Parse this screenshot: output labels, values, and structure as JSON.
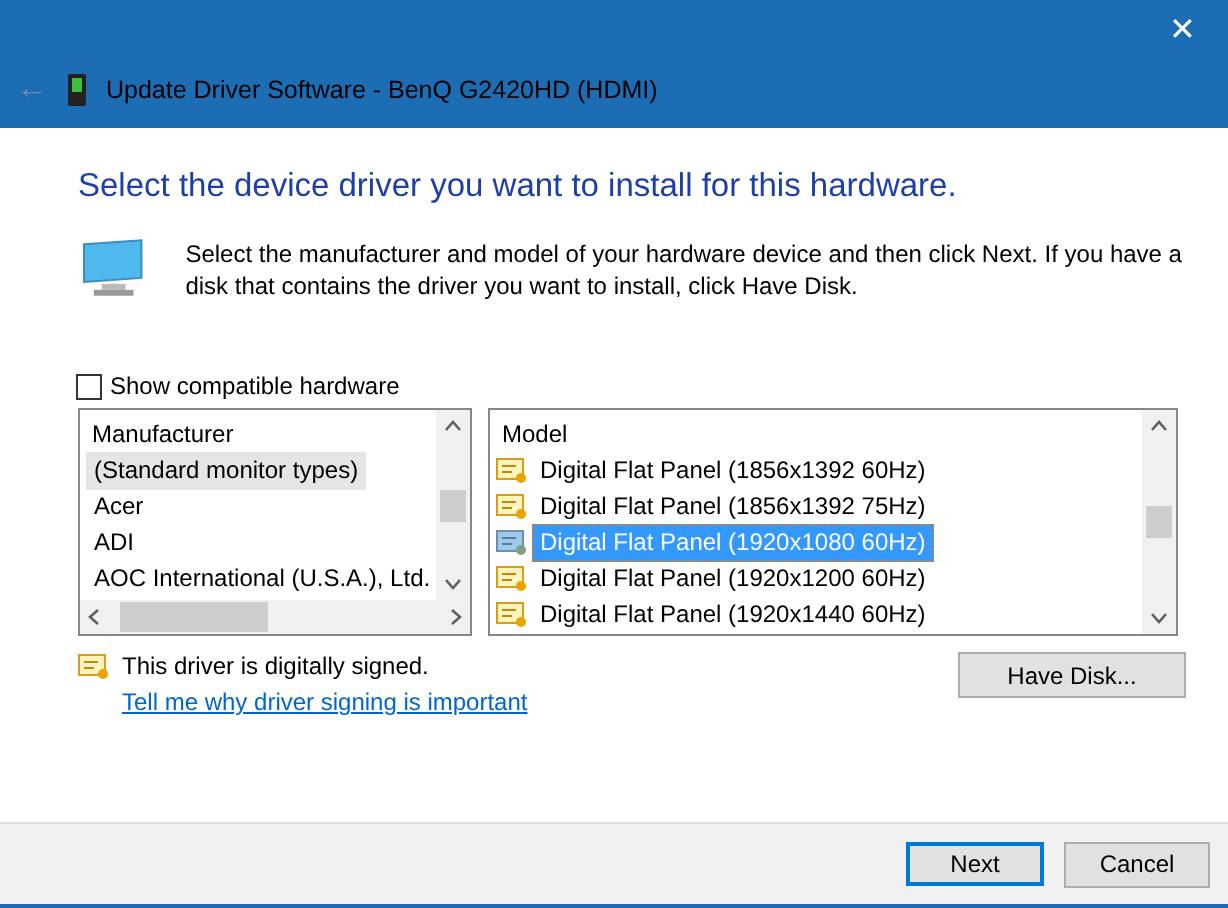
{
  "window": {
    "title": "Update Driver Software - BenQ G2420HD (HDMI)",
    "close": "✕",
    "back": "←"
  },
  "heading": "Select the device driver you want to install for this hardware.",
  "description": "Select the manufacturer and model of your hardware device and then click Next. If you have a disk that contains the driver you want to install, click Have Disk.",
  "show_compatible": {
    "label": "Show compatible hardware",
    "checked": false
  },
  "manufacturer_list": {
    "header": "Manufacturer",
    "items": [
      {
        "label": "(Standard monitor types)",
        "selected": true
      },
      {
        "label": "Acer",
        "selected": false
      },
      {
        "label": "ADI",
        "selected": false
      },
      {
        "label": "AOC International (U.S.A.), Ltd.",
        "selected": false
      }
    ]
  },
  "model_list": {
    "header": "Model",
    "items": [
      {
        "label": "Digital Flat Panel (1856x1392 60Hz)",
        "selected": false
      },
      {
        "label": "Digital Flat Panel (1856x1392 75Hz)",
        "selected": false
      },
      {
        "label": "Digital Flat Panel (1920x1080 60Hz)",
        "selected": true
      },
      {
        "label": "Digital Flat Panel (1920x1200 60Hz)",
        "selected": false
      },
      {
        "label": "Digital Flat Panel (1920x1440 60Hz)",
        "selected": false
      }
    ]
  },
  "signed_message": "This driver is digitally signed.",
  "signing_link": "Tell me why driver signing is important",
  "buttons": {
    "have_disk": "Have Disk...",
    "next": "Next",
    "cancel": "Cancel"
  }
}
